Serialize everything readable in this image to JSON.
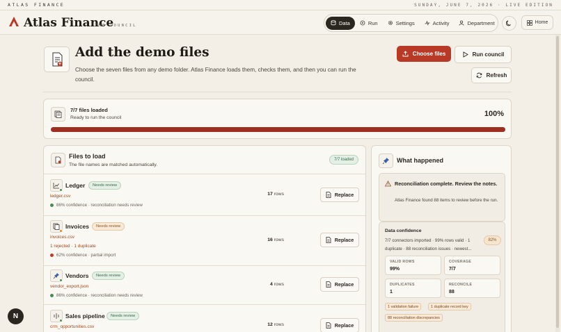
{
  "topstrip": {
    "brand": "ATLAS FINANCE",
    "date": "SUNDAY, JUNE 7, 2026 · LIVE EDITION"
  },
  "header": {
    "title": "Atlas Finance",
    "subtitle": "THE COUNCIL",
    "nav": [
      {
        "label": "Data",
        "icon": "database-icon",
        "active": true
      },
      {
        "label": "Run",
        "icon": "run-icon",
        "active": false
      },
      {
        "label": "Settings",
        "icon": "gear-icon",
        "active": false
      },
      {
        "label": "Activity",
        "icon": "activity-icon",
        "active": false
      },
      {
        "label": "Department",
        "icon": "person-icon",
        "active": false
      }
    ],
    "home_label": "Home"
  },
  "page": {
    "title": "Add the demo files",
    "description": "Choose the seven files from any demo folder. Atlas Finance loads them, checks them, and then you can run the council.",
    "choose_files": "Choose files",
    "run_council": "Run council",
    "refresh": "Refresh"
  },
  "status": {
    "title": "7/7 files loaded",
    "subtitle": "Ready to run the council",
    "percent_label": "100%",
    "progress": 1.0
  },
  "files": {
    "title": "Files to load",
    "subtitle": "The file names are matched automatically.",
    "loaded_pill": "7/7 loaded",
    "items": [
      {
        "name": "Ledger",
        "badge": "Needs review",
        "badge_color": "green",
        "filename": "ledger.csv",
        "extra": "",
        "confidence": "86% confidence · reconciliation needs review",
        "conf_color": "#4c8a55",
        "rows_num": "17",
        "rows_unit": "rows",
        "replace": "Replace"
      },
      {
        "name": "Invoices",
        "badge": "Needs review",
        "badge_color": "orange",
        "filename": "invoices.csv",
        "extra": "1 rejected · 1 duplicate",
        "confidence": "62% confidence · partial import",
        "conf_color": "#c0392b",
        "rows_num": "16",
        "rows_unit": "rows",
        "replace": "Replace"
      },
      {
        "name": "Vendors",
        "badge": "Needs review",
        "badge_color": "green",
        "filename": "vendor_export.json",
        "extra": "",
        "confidence": "86% confidence · reconciliation needs review",
        "conf_color": "#4c8a55",
        "rows_num": "4",
        "rows_unit": "rows",
        "replace": "Replace"
      },
      {
        "name": "Sales pipeline",
        "badge": "Needs review",
        "badge_color": "green",
        "filename": "crm_opportunities.csv",
        "extra": "",
        "confidence": "",
        "conf_color": "#4c8a55",
        "rows_num": "12",
        "rows_unit": "rows",
        "replace": "Replace"
      }
    ]
  },
  "what": {
    "title": "What happened",
    "alert_title": "Reconciliation complete. Review the notes.",
    "alert_desc": "Atlas Finance found 88 items to review before the run.",
    "conf_title": "Data confidence",
    "conf_desc": "7/7 connectors imported · 99% rows valid · 1 duplicate · 88 reconciliation issues · newest...",
    "conf_pill": "82%",
    "stats": [
      {
        "label": "VALID ROWS",
        "value": "99%"
      },
      {
        "label": "COVERAGE",
        "value": "7/7"
      },
      {
        "label": "DUPLICATES",
        "value": "1"
      },
      {
        "label": "RECONCILE",
        "value": "88"
      }
    ],
    "tags": [
      "1 validation failure",
      "1 duplicate record key",
      "88 reconciliation discrepancies"
    ]
  },
  "fab_label": "N",
  "colors": {
    "accent": "#b83a26",
    "background": "#f3efe6",
    "dark": "#2a2620"
  }
}
